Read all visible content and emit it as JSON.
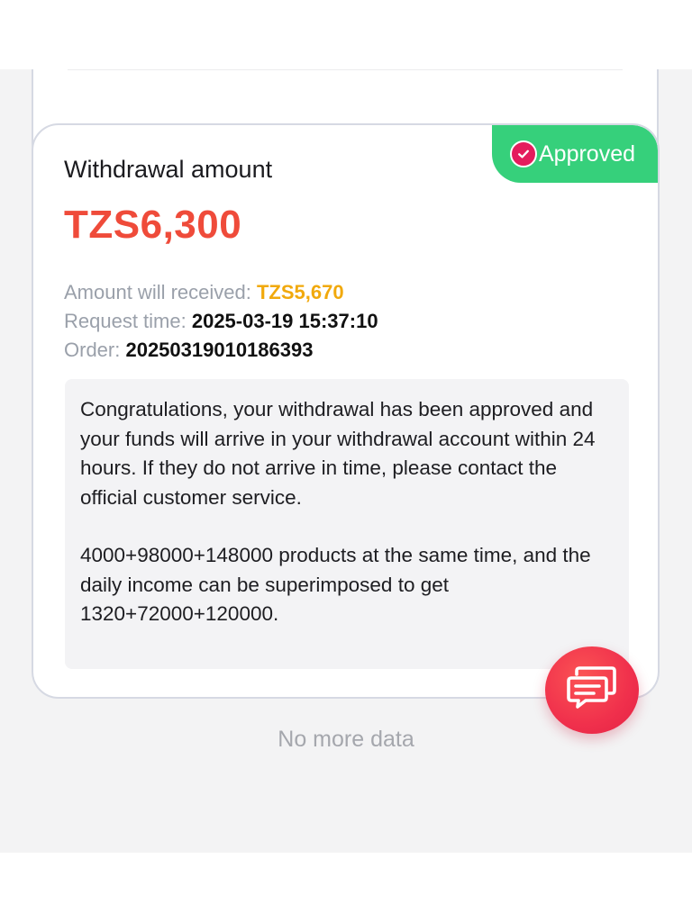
{
  "record": {
    "status_label": "Approved",
    "title": "Withdrawal amount",
    "amount": "TZS6,300",
    "receive_label": "Amount will received: ",
    "receive_value": "TZS5,670",
    "request_label": "Request time: ",
    "request_value": "2025-03-19 15:37:10",
    "order_label": "Order: ",
    "order_value": "20250319010186393",
    "notice_paragraph_1": "Congratulations, your withdrawal has been approved and your funds will arrive in your withdrawal account within 24 hours. If they do not arrive in time, please contact the official customer service.",
    "notice_paragraph_2": "4000+98000+148000 products at the same time, and the daily income can be superimposed to get 1320+72000+120000."
  },
  "list_footer": "No more data",
  "icons": {
    "status": "check-circle-icon",
    "fab": "chat-messages-icon"
  },
  "colors": {
    "approved_badge": "#36d07b",
    "amount": "#ef4b3a",
    "receive_amount": "#f1a90c",
    "fab": "#f0304c"
  }
}
